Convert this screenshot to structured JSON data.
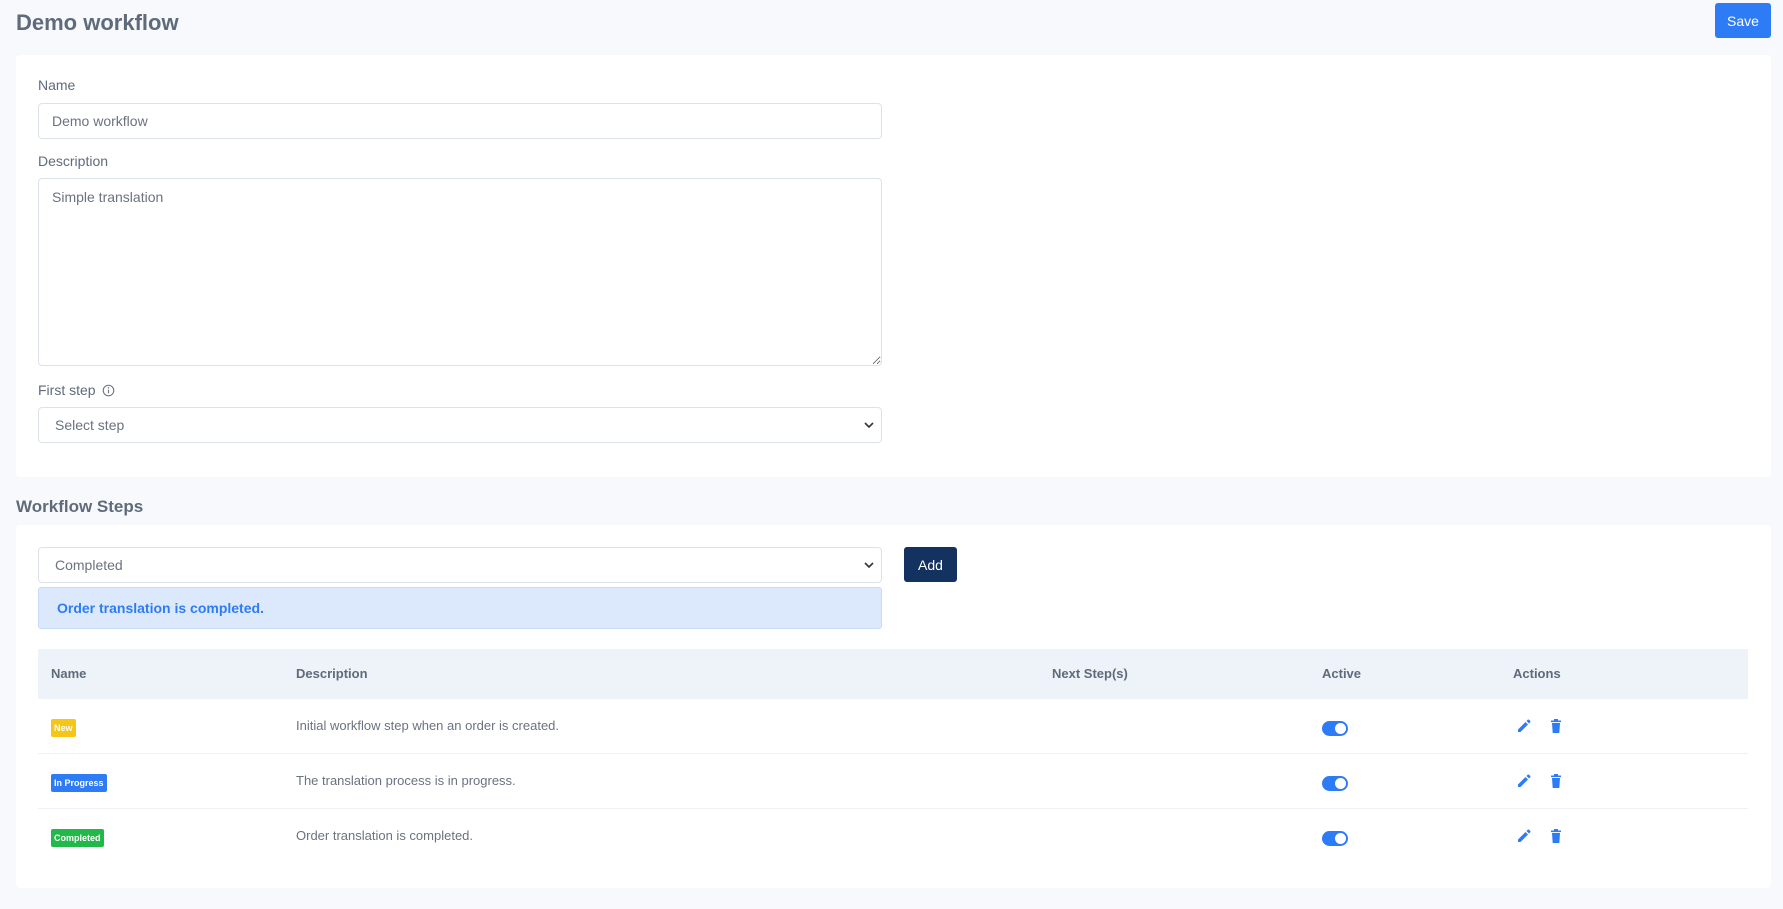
{
  "header": {
    "title": "Demo workflow",
    "save_label": "Save"
  },
  "form": {
    "name_label": "Name",
    "name_value": "Demo workflow",
    "description_label": "Description",
    "description_value": "Simple translation",
    "first_step_label": "First step",
    "first_step_placeholder": "Select step"
  },
  "steps_section": {
    "title": "Workflow Steps",
    "selected_step": "Completed",
    "add_label": "Add",
    "alert_text": "Order translation is completed."
  },
  "table": {
    "headers": {
      "name": "Name",
      "description": "Description",
      "next_steps": "Next Step(s)",
      "active": "Active",
      "actions": "Actions"
    },
    "rows": [
      {
        "badge": "New",
        "badge_color": "#f5c518",
        "description": "Initial workflow step when an order is created.",
        "next_steps": "",
        "active": true
      },
      {
        "badge": "In Progress",
        "badge_color": "#2d7cf6",
        "description": "The translation process is in progress.",
        "next_steps": "",
        "active": true
      },
      {
        "badge": "Completed",
        "badge_color": "#22b84a",
        "description": "Order translation is completed.",
        "next_steps": "",
        "active": true
      }
    ]
  },
  "colors": {
    "primary": "#2d7cf6",
    "dark_button": "#14325f",
    "icons": "#2d7cf6"
  },
  "icons": {
    "info": "info-circle-icon",
    "chevron": "chevron-down-icon",
    "edit": "pencil-icon",
    "delete": "trash-icon"
  }
}
